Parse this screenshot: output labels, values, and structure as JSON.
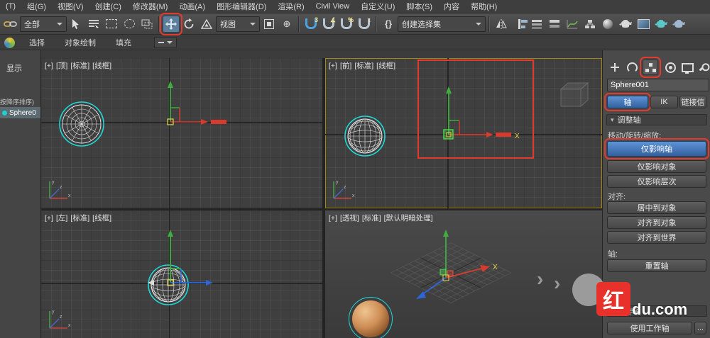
{
  "annotation_color": "#e23b2e",
  "menu": {
    "items": [
      "(T)",
      "组(G)",
      "视图(V)",
      "创建(C)",
      "修改器(M)",
      "动画(A)",
      "图形编辑器(D)",
      "渲染(R)",
      "Civil View",
      "自定义(U)",
      "脚本(S)",
      "内容",
      "帮助(H)"
    ]
  },
  "toolbar": {
    "filter_dropdown": "全部",
    "coord_dropdown": "视图",
    "selection_set_dropdown": "创建选择集",
    "snap_3d_label": "3",
    "angle_snap_label": "∠",
    "percent_snap_label": "%",
    "spinner_snap_label": "↕",
    "braces_label": "{}",
    "manipulate_glyph": "⊕",
    "icons": [
      "select-and-link",
      "select-object",
      "select-by-name",
      "rectangular-selection-region",
      "lasso-selection-region",
      "window-crossing-toggle",
      "select-and-move",
      "select-and-rotate",
      "select-and-scale",
      "use-pivot-point-center",
      "select-and-manipulate",
      "snap-toggle-3d",
      "angle-snap",
      "percent-snap",
      "spinner-snap",
      "edit-named-selection-sets",
      "mirror",
      "align",
      "layer-explorer",
      "ribbon-toggle",
      "curve-editor",
      "schematic-view",
      "material-editor",
      "render-setup",
      "rendered-frame-window",
      "render-production",
      "render-iterative"
    ]
  },
  "ribbon": {
    "tabs": [
      "选择",
      "对象绘制",
      "填充"
    ]
  },
  "scene_explorer": {
    "header": "显示",
    "sort_label": "按降序排序)",
    "selected_item": "Sphere0"
  },
  "viewports": {
    "top_left": {
      "parts": [
        "[+]",
        "[顶]",
        "[标准]",
        "[线框]"
      ]
    },
    "top_right": {
      "parts": [
        "[+]",
        "[前]",
        "[标准]",
        "[线框]"
      ]
    },
    "bottom_left": {
      "parts": [
        "[+]",
        "[左]",
        "[标准]",
        "[线框]"
      ]
    },
    "bottom_right": {
      "parts": [
        "[+]",
        "[透视]",
        "[标准]",
        "[默认明暗处理]"
      ]
    },
    "gizmo_x_label": "X"
  },
  "command_panel": {
    "object_name": "Sphere001",
    "pivot_tab": "轴",
    "ik_tab": "IK",
    "link_info_tab": "链接信",
    "adjust_pivot_rollout": "调整轴",
    "move_rotate_scale_label": "移动/旋转/缩放:",
    "affect_pivot_only": "仅影响轴",
    "affect_object_only": "仅影响对象",
    "affect_hierarchy_only": "仅影响层次",
    "alignment_label": "对齐:",
    "center_to_object": "居中到对象",
    "align_to_object": "对齐到对象",
    "align_to_world": "对齐到世界",
    "pivot_label": "轴:",
    "reset_pivot": "重置轴",
    "working_pivot_rollout": "工作轴",
    "use_working_pivot": "使用工作轴",
    "overflow_button": "..."
  },
  "watermark": {
    "badge": "红",
    "text": "du.com",
    "chevron": "›"
  },
  "colors": {
    "button_active_blue": "#3f6fb5",
    "selection_cyan": "#1fd8d8",
    "axis_x": "#d83a2e",
    "axis_y": "#3fae3f",
    "axis_z": "#2e66d8",
    "active_viewport_border": "#a8860e"
  }
}
